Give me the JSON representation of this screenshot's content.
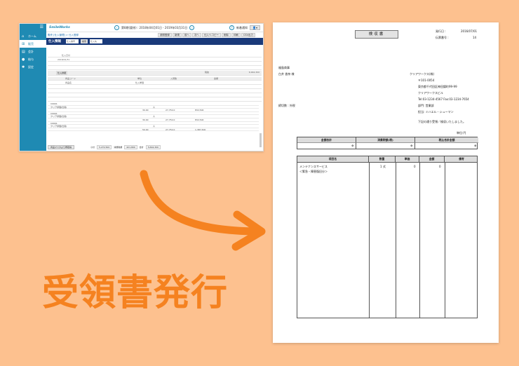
{
  "app": {
    "logo": "SmileWorks",
    "period": "第8期(要修) : 2018年04月01日 - 2019年03月31日",
    "notice": "新着通知",
    "user": "▾"
  },
  "sidebar": [
    {
      "label": "ホーム",
      "icon": "home-icon",
      "glyph": "⌂"
    },
    {
      "label": "販売",
      "icon": "cart-icon",
      "glyph": "⊞"
    },
    {
      "label": "会計",
      "icon": "calculator-icon",
      "glyph": "▤"
    },
    {
      "label": "給与",
      "icon": "coins-icon",
      "glyph": "●"
    },
    {
      "label": "設定",
      "icon": "gear-icon",
      "glyph": "✱"
    }
  ],
  "breadcrumb": "販売 [仕入管理] > 仕入登録",
  "toolbar": [
    "参照登録",
    "新規",
    "前へ",
    "次へ",
    "仕入ヘコピー",
    "削除",
    "印刷",
    "CSV出力"
  ],
  "form": {
    "title": "仕入情報",
    "field1": "仕入番号",
    "search": "検索",
    "field2": "仕入先",
    "field3": "仕入日付",
    "btn": "仕入詳細",
    "date": "2018/01/31",
    "tax": "税抜",
    "amount": "6,994,300"
  },
  "table": {
    "head1": "商品コード",
    "head2": "商品名",
    "head3": "単位",
    "head4": "入荷数",
    "head5": "仕入単価",
    "head6": "金額"
  },
  "rows": [
    {
      "code": "C0001",
      "name": "クリア評価(仕様)",
      "unit": "人",
      "qty": "30.00",
      "price": "27,750.0",
      "amount": "832,500"
    },
    {
      "code": "C0001",
      "name": "クリア評価(仕様)",
      "unit": "人",
      "qty": "30.00",
      "price": "27,750.0",
      "amount": "832,500"
    },
    {
      "code": "C0001",
      "name": "クリア評価(仕様)",
      "unit": "人",
      "qty": "50.00",
      "price": "27,750.0",
      "amount": "1,387,500"
    }
  ],
  "footer": {
    "btn": "商品マスタより再取得",
    "sub": "小計",
    "subv": "5,272,500",
    "tax": "消費税額",
    "taxv": "421,800",
    "total": "合計",
    "totalv": "5,694,300"
  },
  "doc": {
    "title": "検収書",
    "issue_label": "発行日 :",
    "issue_date": "2016/07/01",
    "no_label": "伝票番号 :",
    "no": "14",
    "customer_co": "福島商事",
    "customer": "白井 香奈 様",
    "company": "クリアワークス(株)",
    "zip": "〒101-0054",
    "addr": "東京都千代田区神田錦町99-99",
    "bldg": "クリアワークスビル",
    "tel": "Tel:03-1234-4567 Fax:03-1234-7654",
    "dept": "部門: 営業部",
    "staff": "担当: ミハエル・シューマン",
    "terms": "締切数 : 外税",
    "message": "下記の通り受領／検収いたしました。",
    "unit_note": "単位:円",
    "sum_headers": [
      "金額合計",
      "消費税額(税)",
      "税込合計金額"
    ],
    "sum_values": [
      "0",
      "0",
      "0"
    ],
    "item_headers": [
      "項目名",
      "数量",
      "単価",
      "金額",
      "備考"
    ],
    "item_name": "メンテナンスサービス",
    "item_sub": "＜緊急・障害復旧分＞",
    "item_qty": "1 式",
    "item_price": "0",
    "item_amount": "0"
  },
  "caption": "受領書発行",
  "colors": {
    "accent": "#1f8ab3",
    "navy": "#1a3a7a",
    "orange": "#f58220",
    "bg": "#fdc18f"
  }
}
